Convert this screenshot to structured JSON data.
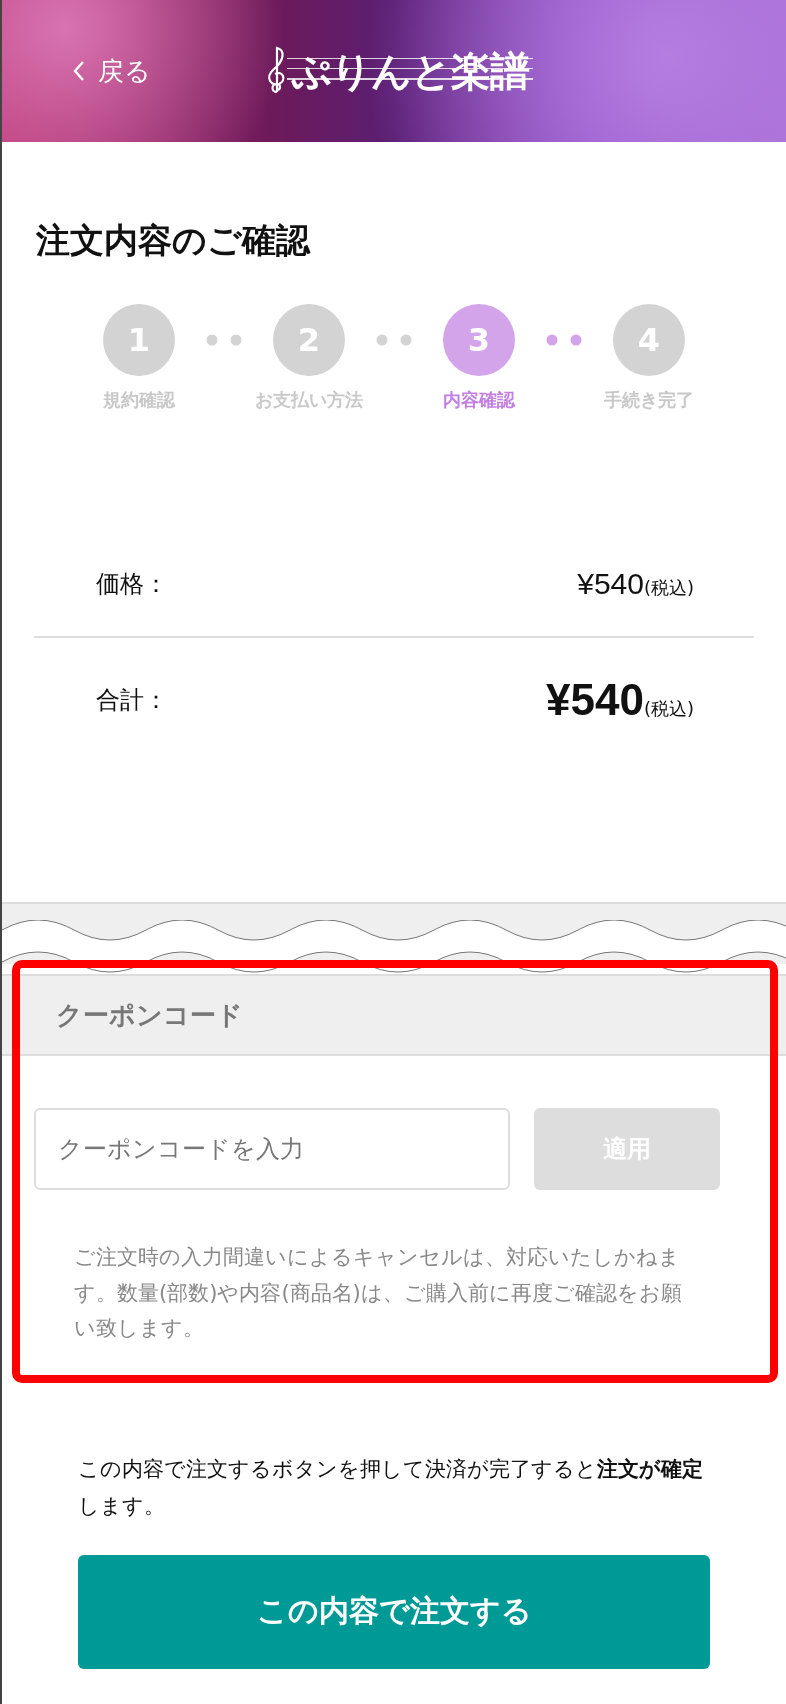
{
  "header": {
    "back_label": "戻る",
    "logo_text": "ぷりんと楽譜"
  },
  "page_title": "注文内容のご確認",
  "steps": [
    {
      "number": "1",
      "label": "規約確認",
      "selected": false
    },
    {
      "number": "2",
      "label": "お支払い方法",
      "selected": false
    },
    {
      "number": "3",
      "label": "内容確認",
      "selected": true
    },
    {
      "number": "4",
      "label": "手続き完了",
      "selected": false
    }
  ],
  "summary": [
    {
      "kind": "price",
      "label": "価格：",
      "amount": "¥540",
      "tax_note": "(税込)"
    },
    {
      "kind": "total",
      "label": "合計：",
      "amount": "¥540",
      "tax_note": "(税込)"
    }
  ],
  "coupon": {
    "heading": "クーポンコード",
    "placeholder": "クーポンコードを入力",
    "apply_label": "適用",
    "disabled": true,
    "note": "ご注文時の入力間違いによるキャンセルは、対応いたしかねます。数量(部数)や内容(商品名)は、ご購入前に再度ご確認をお願い致します。"
  },
  "confirm_note": "この内容で注文するボタンを押して決済が完了すると**注文が確定**します。",
  "order_button": "この内容で注文する"
}
